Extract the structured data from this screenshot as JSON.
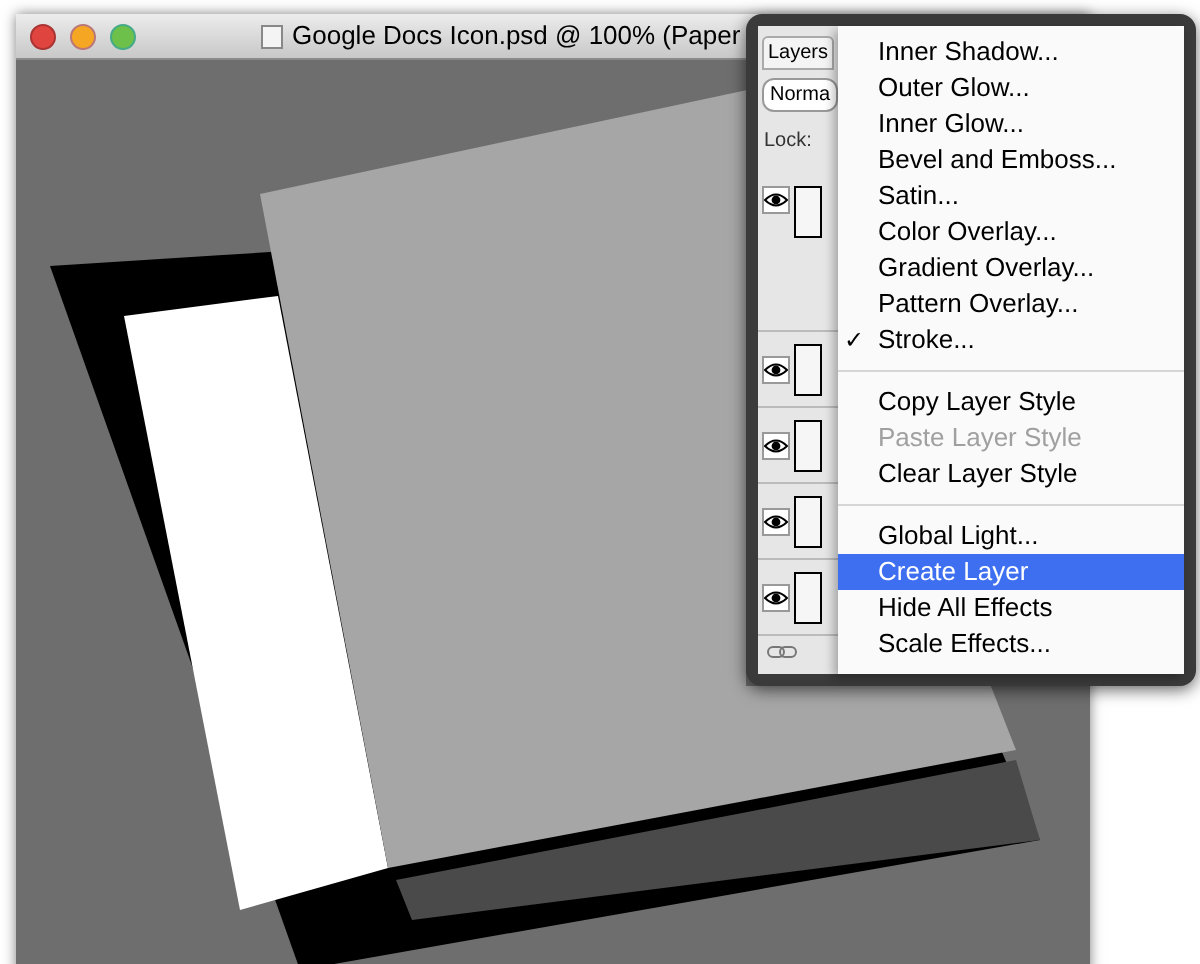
{
  "window": {
    "title": "Google Docs Icon.psd @ 100% (Paper"
  },
  "layers_panel": {
    "tab": "Layers",
    "blend_mode": "Norma",
    "lock_label": "Lock:",
    "layers": [
      {
        "visible": true
      },
      {
        "visible": true
      },
      {
        "visible": true
      },
      {
        "visible": true
      },
      {
        "visible": true
      }
    ]
  },
  "context_menu": {
    "check_glyph": "✓",
    "items": [
      {
        "kind": "item",
        "label": "Inner Shadow...",
        "checked": false,
        "disabled": false,
        "selected": false
      },
      {
        "kind": "item",
        "label": "Outer Glow...",
        "checked": false,
        "disabled": false,
        "selected": false
      },
      {
        "kind": "item",
        "label": "Inner Glow...",
        "checked": false,
        "disabled": false,
        "selected": false
      },
      {
        "kind": "item",
        "label": "Bevel and Emboss...",
        "checked": false,
        "disabled": false,
        "selected": false
      },
      {
        "kind": "item",
        "label": "Satin...",
        "checked": false,
        "disabled": false,
        "selected": false
      },
      {
        "kind": "item",
        "label": "Color Overlay...",
        "checked": false,
        "disabled": false,
        "selected": false
      },
      {
        "kind": "item",
        "label": "Gradient Overlay...",
        "checked": false,
        "disabled": false,
        "selected": false
      },
      {
        "kind": "item",
        "label": "Pattern Overlay...",
        "checked": false,
        "disabled": false,
        "selected": false
      },
      {
        "kind": "item",
        "label": "Stroke...",
        "checked": true,
        "disabled": false,
        "selected": false
      },
      {
        "kind": "separator"
      },
      {
        "kind": "item",
        "label": "Copy Layer Style",
        "checked": false,
        "disabled": false,
        "selected": false
      },
      {
        "kind": "item",
        "label": "Paste Layer Style",
        "checked": false,
        "disabled": true,
        "selected": false
      },
      {
        "kind": "item",
        "label": "Clear Layer Style",
        "checked": false,
        "disabled": false,
        "selected": false
      },
      {
        "kind": "separator"
      },
      {
        "kind": "item",
        "label": "Global Light...",
        "checked": false,
        "disabled": false,
        "selected": false
      },
      {
        "kind": "item",
        "label": "Create Layer",
        "checked": false,
        "disabled": false,
        "selected": true
      },
      {
        "kind": "item",
        "label": "Hide All Effects",
        "checked": false,
        "disabled": false,
        "selected": false
      },
      {
        "kind": "item",
        "label": "Scale Effects...",
        "checked": false,
        "disabled": false,
        "selected": false
      }
    ]
  }
}
